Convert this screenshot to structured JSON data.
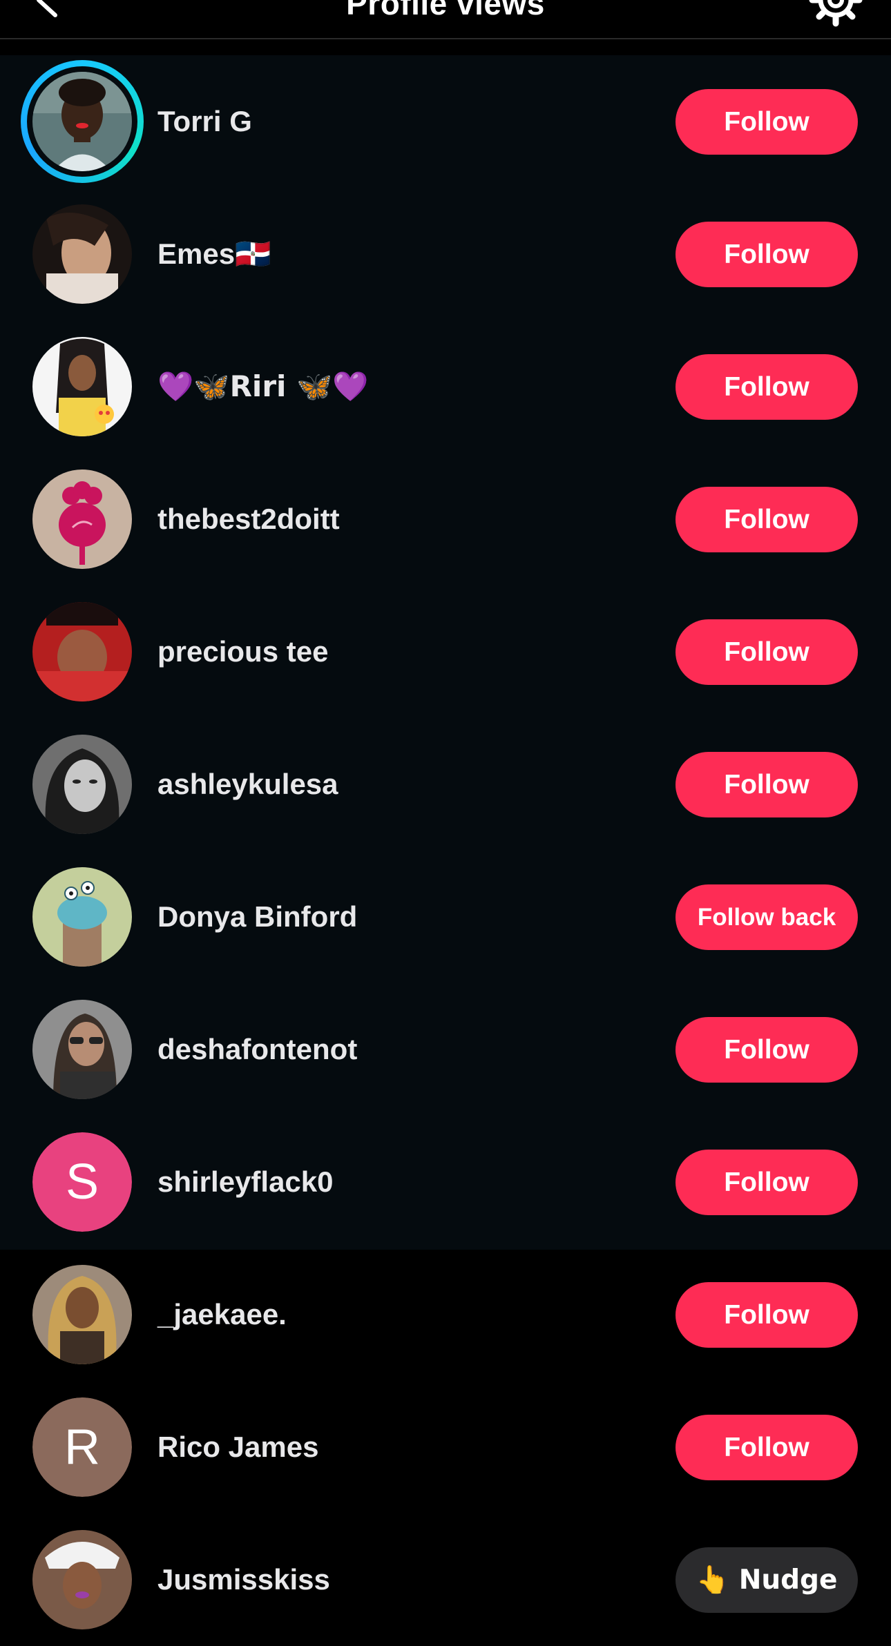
{
  "header": {
    "title": "Profile views"
  },
  "colors": {
    "follow_button": "#fe2c55",
    "nudge_button": "#2b2b2d",
    "background": "#000000",
    "band_background": "#050b0f",
    "story_ring": "#18c8ff"
  },
  "viewers": [
    {
      "name": "Torri G",
      "action": "Follow",
      "has_story": true
    },
    {
      "name": "Emes🇩🇴",
      "action": "Follow"
    },
    {
      "name": "💜🦋Riri 🦋💜",
      "action": "Follow"
    },
    {
      "name": "thebest2doitt",
      "action": "Follow"
    },
    {
      "name": "precious tee",
      "action": "Follow"
    },
    {
      "name": "ashleykulesa",
      "action": "Follow"
    },
    {
      "name": "Donya Binford",
      "action": "Follow back"
    },
    {
      "name": "deshafontenot",
      "action": "Follow"
    },
    {
      "name": "shirleyflack0",
      "action": "Follow",
      "avatar_letter": "S",
      "avatar_color": "#e8427f"
    },
    {
      "name": "_jaekaee.",
      "action": "Follow"
    },
    {
      "name": "Rico James",
      "action": "Follow",
      "avatar_letter": "R",
      "avatar_color": "#8b6a5c"
    },
    {
      "name": "Jusmisskiss",
      "action": "👆 Nudge"
    }
  ]
}
